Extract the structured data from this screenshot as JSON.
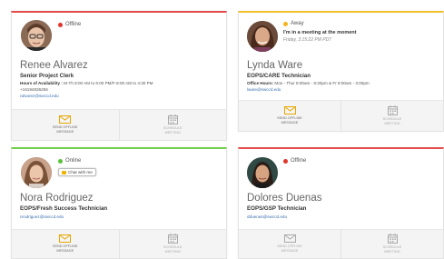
{
  "cards": [
    {
      "status": "Offline",
      "status_color": "#e0352b",
      "border_color": "#e34b4b",
      "name": "Renee Alvarez",
      "title": "Senior Project Clerk",
      "hours_label": "Hours of Availability :",
      "hours": "M-Th 8:00 AM to 6:00 PM/F-8:00 AM to 4:30 PM",
      "phone": "+16194836256",
      "email": "ralvarez@swccd.edu",
      "message_label": "SEND OFFLINE MESSAGE",
      "schedule_label": "SCHEDULE MEETING"
    },
    {
      "status": "Away",
      "status_color": "#f2b51c",
      "border_color": "#f2c12e",
      "note": "I'm in a meeting at the moment",
      "note_time": "Friday, 3:15:22 PM PDT",
      "name": "Lynda Ware",
      "title": "EOPS/CARE Technician",
      "hours_label": "Office Hours:",
      "hours": "Mon - Thur 8:00am - 6:30pm & Fr 8:00am - 3:00pm",
      "email": "lware@swccd.edu",
      "message_label": "SEND OFFLINE MESSAGE",
      "schedule_label": "SCHEDULE MEETING"
    },
    {
      "status": "Online",
      "status_color": "#57c23a",
      "border_color": "#6fcf4a",
      "chat_label": "Chat with me",
      "name": "Nora Rodriguez",
      "title": "EOPS/Fresh Success Technician",
      "email": "nrodriguez@swccd.edu",
      "message_label": "SEND OFFLINE MESSAGE",
      "schedule_label": "SCHEDULE MEETING"
    },
    {
      "status": "Offline",
      "status_color": "#e0352b",
      "border_color": "#e34b4b",
      "name": "Dolores Duenas",
      "title": "EOPS/GSP Technician",
      "email": "dduenas@swccd.edu",
      "message_label": "SEND OFFLINE MESSAGE",
      "schedule_label": "SCHEDULE MEETING"
    }
  ],
  "icons": {
    "message": "envelope-icon",
    "schedule": "calendar-icon"
  }
}
